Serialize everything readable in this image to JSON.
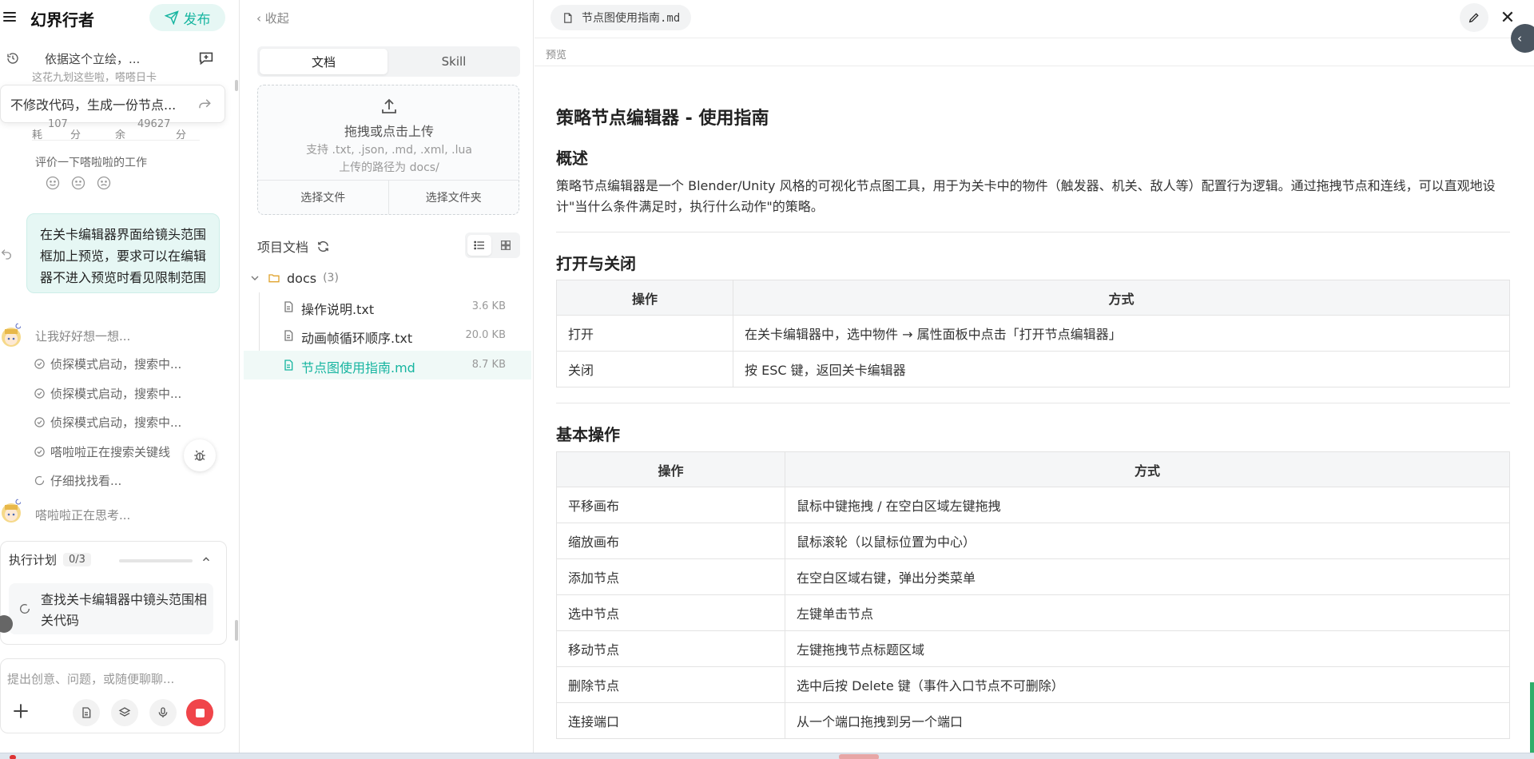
{
  "chat": {
    "app_title": "幻界行者",
    "publish_label": "发布",
    "conversation_title": "依据这个立绘，...",
    "faded_line": "这花九划这些啦，嗒嗒日卡",
    "suggestion": "不修改代码，生成一份节点...",
    "stats": {
      "used_label": "耗",
      "used_value": "107",
      "used_unit": "分",
      "left_label": "余",
      "left_value": "49627",
      "left_unit": "分"
    },
    "rate_label": "评价一下嗒啦啦的工作",
    "user_message": "在关卡编辑器界面给镜头范围框加上预览，要求可以在编辑器不进入预览时看见限制范围",
    "thinking_1": "让我好好想一想...",
    "steps": [
      {
        "label": "侦探模式启动，搜索中...",
        "state": "done"
      },
      {
        "label": "侦探模式启动，搜索中...",
        "state": "done"
      },
      {
        "label": "侦探模式启动，搜索中...",
        "state": "done"
      },
      {
        "label": "嗒啦啦正在搜索关键线",
        "state": "done"
      },
      {
        "label": "仔细找找看...",
        "state": "loading"
      }
    ],
    "thinking_2": "嗒啦啦正在思考...",
    "plan": {
      "title": "执行计划",
      "count": "0/3",
      "progress": 0,
      "task": "查找关卡编辑器中镜头范围相关代码"
    },
    "input_placeholder": "提出创意、问题，或随便聊聊..."
  },
  "files": {
    "collapse_label": "收起",
    "tabs": [
      {
        "label": "文档",
        "active": true
      },
      {
        "label": "Skill",
        "active": false
      }
    ],
    "upload": {
      "title": "拖拽或点击上传",
      "formats": "支持 .txt, .json, .md, .xml, .lua",
      "path": "上传的路径为 docs/",
      "choose_file": "选择文件",
      "choose_folder": "选择文件夹"
    },
    "project_title": "项目文档",
    "folder": {
      "name": "docs",
      "count": "(3)"
    },
    "items": [
      {
        "name": "操作说明.txt",
        "size": "3.6 KB",
        "active": false
      },
      {
        "name": "动画帧循环顺序.txt",
        "size": "20.0 KB",
        "active": false
      },
      {
        "name": "节点图使用指南.md",
        "size": "8.7 KB",
        "active": true
      }
    ]
  },
  "preview": {
    "file_tab": "节点图使用指南.md",
    "label": "预览",
    "doc": {
      "title": "策略节点编辑器 - 使用指南",
      "overview_heading": "概述",
      "overview_text": "策略节点编辑器是一个 Blender/Unity 风格的可视化节点图工具，用于为关卡中的物件（触发器、机关、敌人等）配置行为逻辑。通过拖拽节点和连线，可以直观地设计\"当什么条件满足时，执行什么动作\"的策略。",
      "open_close_heading": "打开与关闭",
      "table1": {
        "headers": [
          "操作",
          "方式"
        ],
        "rows": [
          [
            "打开",
            "在关卡编辑器中，选中物件 → 属性面板中点击「打开节点编辑器」"
          ],
          [
            "关闭",
            "按 ESC 键，返回关卡编辑器"
          ]
        ]
      },
      "basic_heading": "基本操作",
      "table2": {
        "headers": [
          "操作",
          "方式"
        ],
        "rows": [
          [
            "平移画布",
            "鼠标中键拖拽 / 在空白区域左键拖拽"
          ],
          [
            "缩放画布",
            "鼠标滚轮（以鼠标位置为中心）"
          ],
          [
            "添加节点",
            "在空白区域右键，弹出分类菜单"
          ],
          [
            "选中节点",
            "左键单击节点"
          ],
          [
            "移动节点",
            "左键拖拽节点标题区域"
          ],
          [
            "删除节点",
            "选中后按 Delete 键（事件入口节点不可删除）"
          ],
          [
            "连接端口",
            "从一个端口拖拽到另一个端口"
          ]
        ]
      }
    }
  }
}
